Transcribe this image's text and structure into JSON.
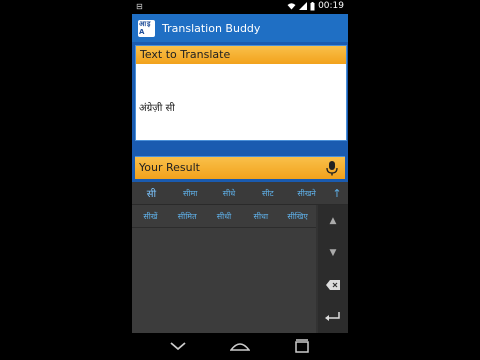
{
  "status": {
    "time": "00:19"
  },
  "app": {
    "title": "Translation Buddy",
    "logo_top": "इ",
    "logo_bottom": "A",
    "logo_left": "आ"
  },
  "input": {
    "header": "Text to Translate",
    "text": "अंग्रेज़ी सी"
  },
  "result": {
    "label": "Your Result"
  },
  "keyboard": {
    "suggestions": [
      "सी",
      "सीमा",
      "सीधे",
      "सीट",
      "सीखने"
    ],
    "row2": [
      "सीखें",
      "सीमित",
      "सीधी",
      "सीधा",
      "सीखिए"
    ]
  },
  "icons": {
    "mic": "mic-icon",
    "up": "arrow-up-icon",
    "delete": "backspace-icon",
    "enter": "enter-icon",
    "back": "nav-back-icon",
    "home": "nav-home-icon",
    "recents": "nav-recents-icon"
  },
  "colors": {
    "appbar": "#1f6fc4",
    "header": "#f2a21c",
    "suggestion": "#5fb0e8"
  }
}
